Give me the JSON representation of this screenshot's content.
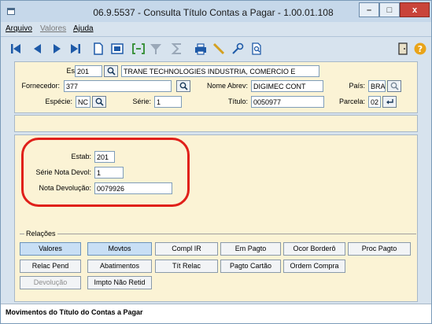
{
  "window": {
    "title": "06.9.5537 - Consulta Título Contas a Pagar - 1.00.01.108",
    "minimize_symbol": "–",
    "maximize_symbol": "□",
    "close_symbol": "x"
  },
  "menu": [
    {
      "label": "Arquivo",
      "enabled": true
    },
    {
      "label": "Valores",
      "enabled": false
    },
    {
      "label": "Ajuda",
      "enabled": true
    }
  ],
  "toolbar": {
    "icons": [
      "first-icon",
      "previous-icon",
      "next-icon",
      "last-icon",
      "new-document-icon",
      "preview-icon",
      "goto-icon",
      "filter-icon",
      "sum-icon",
      "print-icon",
      "pen-icon",
      "wrench-icon",
      "search-document-icon",
      "exit-door-icon",
      "help-icon"
    ]
  },
  "header": {
    "estab_label": "Estab:",
    "estab_value": "201",
    "estab_name": "TRANE TECHNOLOGIES INDUSTRIA, COMERCIO E",
    "fornecedor_label": "Fornecedor:",
    "fornecedor_value": "377",
    "nome_abrev_label": "Nome Abrev:",
    "nome_abrev_value": "DIGIMEC CONT",
    "pais_label": "País:",
    "pais_value": "BRA",
    "especie_label": "Espécie:",
    "especie_value": "NC",
    "serie_label": "Série:",
    "serie_value": "1",
    "titulo_label": "Título:",
    "titulo_value": "0050977",
    "parcela_label": "Parcela:",
    "parcela_value": "02"
  },
  "detail": {
    "estab_label": "Estab:",
    "estab_value": "201",
    "serie_devol_label": "Série Nota Devol:",
    "serie_devol_value": "1",
    "nota_devol_label": "Nota Devolução:",
    "nota_devol_value": "0079926"
  },
  "relacoes": {
    "title": "Relações",
    "buttons": [
      {
        "label": "Valores",
        "state": "active"
      },
      {
        "label": "Movtos",
        "state": "active"
      },
      {
        "label": "Compl IR",
        "state": "normal"
      },
      {
        "label": "Em Pagto",
        "state": "normal"
      },
      {
        "label": "Ocor Borderô",
        "state": "normal"
      },
      {
        "label": "Proc Pagto",
        "state": "normal"
      },
      {
        "label": "Relac Pend",
        "state": "normal"
      },
      {
        "label": "Abatimentos",
        "state": "normal"
      },
      {
        "label": "Tít Relac",
        "state": "normal"
      },
      {
        "label": "Pagto Cartão",
        "state": "normal"
      },
      {
        "label": "Ordem Compra",
        "state": "normal"
      },
      {
        "label": "Devolução",
        "state": "disabled"
      },
      {
        "label": "Impto Não Retid",
        "state": "normal"
      }
    ]
  },
  "status": {
    "text": "Movimentos do Título do Contas a Pagar"
  },
  "colors": {
    "highlight": "#e0201a",
    "panel": "#fbf3d5",
    "toolbar_icon": "#1e5aa8"
  }
}
